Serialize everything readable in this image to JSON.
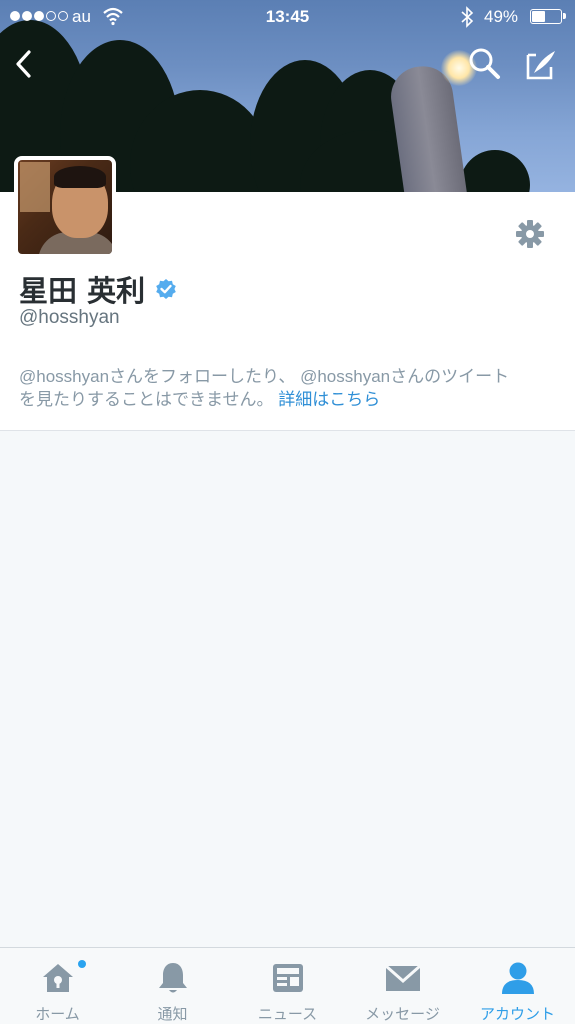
{
  "status_bar": {
    "carrier": "au",
    "time": "13:45",
    "battery_percent": "49%",
    "signal_bars_filled": 3,
    "signal_bars_total": 5,
    "battery_level": 0.49
  },
  "header": {
    "back_icon": "chevron-left-icon",
    "search_icon": "search-icon",
    "compose_icon": "compose-icon"
  },
  "profile": {
    "name": "星田 英利",
    "verified": true,
    "handle": "@hosshyan",
    "notice_line1": "@hosshyanさんをフォローしたり、 @hosshyanさんのツイート",
    "notice_line2": "を見たりすることはできません。",
    "notice_link": "詳細はこちら",
    "settings_icon": "gear-icon"
  },
  "colors": {
    "accent": "#2f9ee8",
    "verified": "#55acee",
    "text_dark": "#292f33",
    "text_muted": "#8899a6",
    "background": "#f5f8fa"
  },
  "tabs": [
    {
      "label": "ホーム",
      "icon": "home-icon",
      "active": false,
      "badge": true
    },
    {
      "label": "通知",
      "icon": "bell-icon",
      "active": false,
      "badge": false
    },
    {
      "label": "ニュース",
      "icon": "news-icon",
      "active": false,
      "badge": false
    },
    {
      "label": "メッセージ",
      "icon": "envelope-icon",
      "active": false,
      "badge": false
    },
    {
      "label": "アカウント",
      "icon": "person-icon",
      "active": true,
      "badge": false
    }
  ]
}
